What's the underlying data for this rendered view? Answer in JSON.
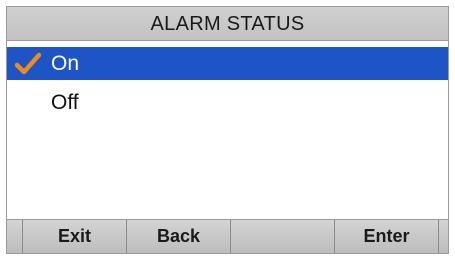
{
  "header": {
    "title": "ALARM STATUS"
  },
  "options": [
    {
      "label": "On",
      "selected": true,
      "checked": true
    },
    {
      "label": "Off",
      "selected": false,
      "checked": false
    }
  ],
  "softkeys": {
    "exit": "Exit",
    "back": "Back",
    "blank": "",
    "enter": "Enter"
  },
  "icons": {
    "check": "check-icon"
  },
  "colors": {
    "highlight": "#1d54c6",
    "check": "#f08a1c",
    "title_bar": "#c8c8c8",
    "softkey_bar": "#c8c8c8"
  }
}
